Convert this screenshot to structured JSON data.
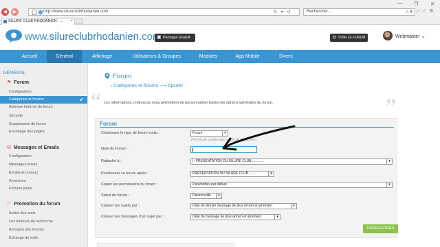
{
  "browser": {
    "url": "http://www.silureclubrhodanien.com",
    "tab_title": "SILURE CLUB RHODANIEN - ...",
    "search_placeholder": "Rechercher...",
    "back_glyph": "◀",
    "forward_glyph": "▶",
    "url_controls": "↻ ▾ ↺",
    "toolbar_glyphs": "⌂ ☆ ⚙"
  },
  "header": {
    "logo_prefix": "www.",
    "logo_name": "silureclubrhodanien",
    "logo_suffix": ".com",
    "package_label": "Package Gratuit",
    "visit_label": "VOIR LE FORUM",
    "user_name": "Webmaster"
  },
  "main_nav": [
    {
      "label": "Accueil",
      "active": false
    },
    {
      "label": "Général",
      "active": true
    },
    {
      "label": "Affichage",
      "active": false
    },
    {
      "label": "Utilisateurs & Groupes",
      "active": false
    },
    {
      "label": "Modules",
      "active": false
    },
    {
      "label": "App Mobile",
      "active": false
    },
    {
      "label": "Divers",
      "active": false
    }
  ],
  "sidebar": {
    "heading": "GÉNÉRAL",
    "sections": [
      {
        "title": "Forum",
        "items": [
          {
            "label": "Configuration",
            "active": false
          },
          {
            "label": "Catégories et forums",
            "active": true
          },
          {
            "label": "Adresse Internet du forum",
            "active": false
          },
          {
            "label": "Sécurité",
            "active": false
          },
          {
            "label": "Suppression du forum",
            "active": false
          },
          {
            "label": "Encodage des pages",
            "active": false
          }
        ]
      },
      {
        "title": "Messages et Emails",
        "items": [
          {
            "label": "Configuration",
            "active": false
          },
          {
            "label": "Messages privés",
            "active": false
          },
          {
            "label": "Emails et contact",
            "active": false
          },
          {
            "label": "Annonces",
            "active": false
          },
          {
            "label": "Fichiers joints",
            "active": false
          }
        ]
      },
      {
        "title": "Promotion du forum",
        "items": [
          {
            "label": "Inviter des amis",
            "active": false
          },
          {
            "label": "Les moteurs de recherche",
            "active": false
          },
          {
            "label": "Annuaire des forums",
            "active": false
          },
          {
            "label": "Échange de trafic",
            "active": false
          }
        ]
      }
    ]
  },
  "content": {
    "title": "Forum",
    "breadcrumb": "› Catégories et forums ⟶ Ajouter",
    "intro": "Les informations ci-dessous vous permettent de personnaliser toutes les options générales du forum.",
    "form": {
      "title": "Forum",
      "fields": [
        {
          "label": "Choisissez le type de forum voulu :",
          "value": "Forum",
          "hint": "Permet de publier des sujets de discussion."
        },
        {
          "label": "Nom du Forum :",
          "value": ""
        },
        {
          "label": "Rattaché à :",
          "value": "|--PRESENTATION DU SILURE CLUB ............"
        },
        {
          "label": "Positionner ce forum après :",
          "value": "PRESENTATION DU SILURE CLUB ........"
        },
        {
          "label": "Copier les permissions du forum :",
          "value": "Paramètres par défaut"
        },
        {
          "label": "Statut du forum :",
          "value": "Déverrouillé"
        },
        {
          "label": "Classer les sujets par :",
          "value": "Date du dernier message (le plus récent en premier)"
        },
        {
          "label": "Classer les messages d'un sujet par :",
          "value": "Date du message (le plus ancien en premier)"
        }
      ],
      "save_label": "ENREGISTRER"
    }
  },
  "colors": {
    "accent": "#3a96d2",
    "accent_dark": "#2878b0",
    "save": "#8cc34a",
    "section_icon": "#d9534f"
  },
  "icons": {
    "logo": "speech-bubble-icon",
    "package": "package-icon",
    "visit": "external-link-icon",
    "page_title": "map-pin-icon",
    "sidebar_forum": "flag-icon",
    "sidebar_messages": "envelope-icon",
    "sidebar_promotion": "megaphone-icon",
    "active_item": "check-icon"
  }
}
